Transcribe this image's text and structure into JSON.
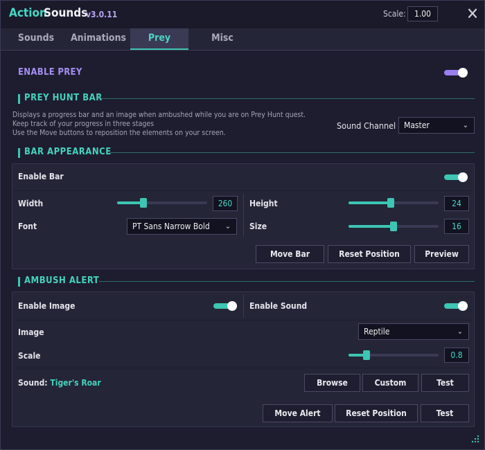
{
  "header": {
    "title_a": "Action",
    "title_b": "Sounds",
    "version": "v3.0.11",
    "scale_label": "Scale:",
    "scale_value": "1.00",
    "close_glyph": "✕"
  },
  "tabs": [
    {
      "label": "Sounds",
      "active": false
    },
    {
      "label": "Animations",
      "active": false
    },
    {
      "label": "Prey",
      "active": true
    },
    {
      "label": "Misc",
      "active": false
    }
  ],
  "enable_prey": {
    "label": "ENABLE PREY",
    "on": true
  },
  "prey_hunt_bar": {
    "heading": "PREY HUNT BAR",
    "desc": [
      "Displays a progress bar and an image when ambushed while you are on Prey Hunt quest.",
      "Keep track of your progress in three stages",
      "Use the Move buttons to reposition the elements on your screen."
    ],
    "sound_channel_label": "Sound Channel",
    "sound_channel_value": "Master"
  },
  "bar_appearance": {
    "heading": "BAR APPEARANCE",
    "enable_bar_label": "Enable Bar",
    "enable_bar_on": true,
    "width_label": "Width",
    "width_value": "260",
    "height_label": "Height",
    "height_value": "24",
    "font_label": "Font",
    "font_value": "PT Sans Narrow Bold",
    "size_label": "Size",
    "size_value": "16",
    "buttons": {
      "move": "Move Bar",
      "reset": "Reset Position",
      "preview": "Preview"
    }
  },
  "ambush_alert": {
    "heading": "AMBUSH ALERT",
    "enable_image_label": "Enable Image",
    "enable_image_on": true,
    "enable_sound_label": "Enable Sound",
    "enable_sound_on": true,
    "image_label": "Image",
    "image_value": "Reptile",
    "scale_label": "Scale",
    "scale_value": "0.8",
    "sound_label": "Sound:",
    "sound_name": "Tiger's Roar",
    "buttons": {
      "browse": "Browse",
      "custom": "Custom",
      "test": "Test",
      "move_alert": "Move Alert",
      "reset": "Reset Position",
      "test2": "Test"
    }
  },
  "colors": {
    "accent_teal": "#3cc6b3",
    "accent_purple": "#9b7ff0",
    "background": "#1d1d2f"
  },
  "icons": {
    "close": "close-icon",
    "chevron": "chevron-down-icon",
    "grip": "resize-grip-icon"
  }
}
